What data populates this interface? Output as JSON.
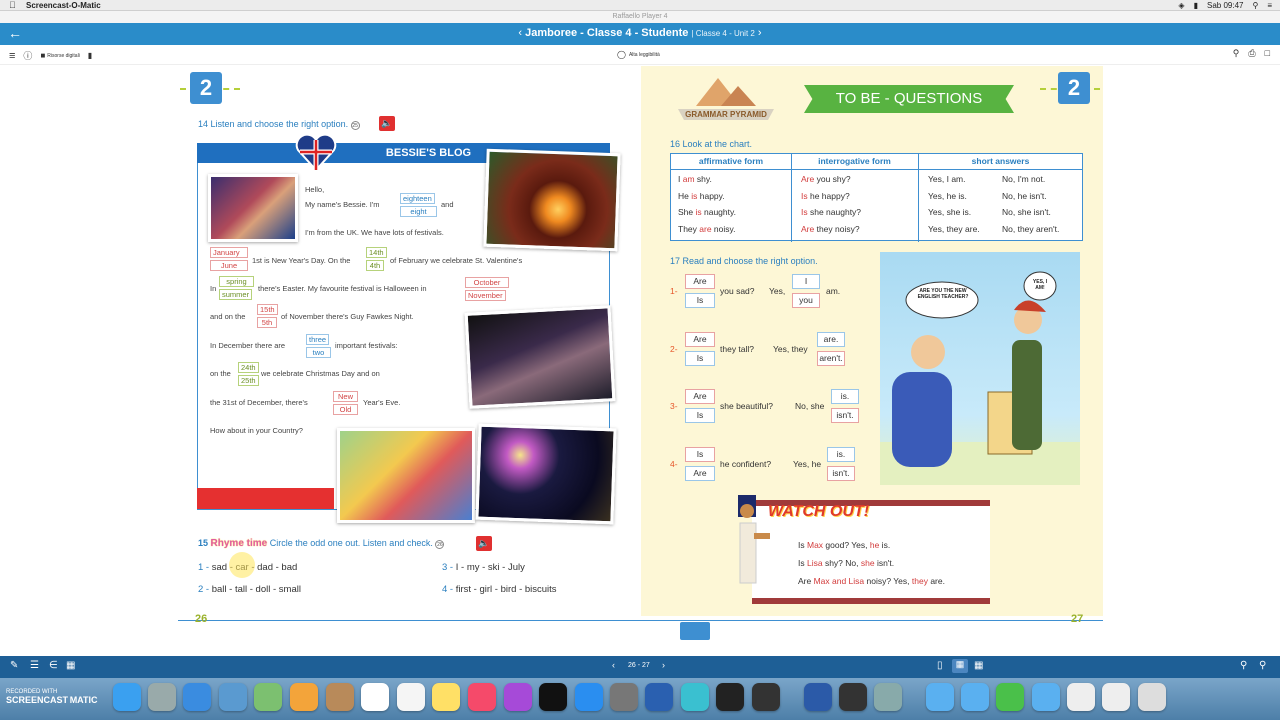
{
  "mac_menubar": {
    "app_name": "Screencast-O-Matic",
    "clock": "Sab 09:47"
  },
  "window_title": "Raffaello Player 4",
  "header": {
    "title": "Jamboree - Classe 4 - Studente",
    "subtitle": "| Classe 4 - Unit 2"
  },
  "toolbar": {
    "risorse_label": "Risorse digitali",
    "alta_leggibilita_label": "Alta leggibilità"
  },
  "left_page": {
    "unit_badge": "2",
    "ex14_title": "14 Listen and choose the right option.",
    "ex14_track": "25",
    "blog_title": "BESSIE'S BLOG",
    "blog_lines": {
      "hello": "Hello,",
      "name_pre": "My name's Bessie. I'm",
      "name_post": "and",
      "uk": "I'm from the UK. We have lots of festivals.",
      "ny": "1st is New Year's Day. On the",
      "valentine": "of February we celebrate St. Valentine's",
      "in": "In",
      "easter": "there's Easter. My favourite festival is Halloween in",
      "and_on_the": "and on the",
      "guy": "of November there's Guy Fawkes Night.",
      "dec": "In December there are",
      "important": "important festivals:",
      "on_the": "on the",
      "xmas": "we celebrate Christmas Day and on",
      "the31": "the 31st of December, there's",
      "yeareve": "Year's Eve.",
      "how": "How about in your Country?"
    },
    "options": {
      "age": [
        "eighteen",
        "eight"
      ],
      "month1": [
        "January",
        "June"
      ],
      "day1": [
        "14th",
        "4th"
      ],
      "season": [
        "spring",
        "summer"
      ],
      "month2": [
        "October",
        "November"
      ],
      "day2": [
        "15th",
        "5th"
      ],
      "count": [
        "three",
        "two"
      ],
      "day3": [
        "24th",
        "25th"
      ],
      "newold": [
        "New",
        "Old"
      ]
    },
    "ex15_num": "15",
    "ex15_rhyme": "Rhyme time",
    "ex15_instruction": "Circle the odd one out. Listen and check.",
    "ex15_track": "26",
    "ex15_items": [
      {
        "n": "1 -",
        "text": "sad - car - dad - bad"
      },
      {
        "n": "2 -",
        "text": "ball - tall - doll - small"
      },
      {
        "n": "3 -",
        "text": "I - my - ski - July"
      },
      {
        "n": "4 -",
        "text": "first - girl - bird - biscuits"
      }
    ],
    "page_number": "26"
  },
  "right_page": {
    "unit_badge": "2",
    "grammar_label": "GRAMMAR PYRAMID",
    "banner": "TO BE - QUESTIONS",
    "ex16_title": "16 Look at the chart.",
    "table": {
      "headers": [
        "affirmative form",
        "interrogative form",
        "short answers"
      ],
      "rows": [
        {
          "a1": "I",
          "a2": "am",
          "a3": "shy.",
          "i1": "Are",
          "i2": "you shy?",
          "s1": "Yes, I am.",
          "s2": "No, I'm not."
        },
        {
          "a1": "He",
          "a2": "is",
          "a3": "happy.",
          "i1": "Is",
          "i2": "he happy?",
          "s1": "Yes, he is.",
          "s2": "No, he isn't."
        },
        {
          "a1": "She",
          "a2": "is",
          "a3": "naughty.",
          "i1": "Is",
          "i2": "she naughty?",
          "s1": "Yes, she is.",
          "s2": "No, she isn't."
        },
        {
          "a1": "They",
          "a2": "are",
          "a3": "noisy.",
          "i1": "Are",
          "i2": "they noisy?",
          "s1": "Yes, they are.",
          "s2": "No, they aren't."
        }
      ]
    },
    "ex17_title": "17 Read and choose the right option.",
    "ex17_items": [
      {
        "n": "1-",
        "o1": "Are",
        "o2": "Is",
        "mid": "you sad?",
        "yes": "Yes,",
        "p1": "I",
        "p2": "you",
        "end": "am."
      },
      {
        "n": "2-",
        "o1": "Are",
        "o2": "Is",
        "mid": "they tall?",
        "yes": "Yes, they",
        "p1": "are.",
        "p2": "aren't."
      },
      {
        "n": "3-",
        "o1": "Are",
        "o2": "Is",
        "mid": "she beautiful?",
        "yes": "No, she",
        "p1": "is.",
        "p2": "isn't."
      },
      {
        "n": "4-",
        "o1": "Is",
        "o2": "Are",
        "mid": "he confident?",
        "yes": "Yes, he",
        "p1": "is.",
        "p2": "isn't."
      }
    ],
    "cartoon_bubble1": "ARE YOU THE NEW ENGLISH TEACHER?",
    "cartoon_bubble2": "YES, I AM!",
    "watch_out": "WATCH OUT!",
    "watch_lines": [
      {
        "a": "Is ",
        "b": "Max",
        "c": " good? Yes, ",
        "d": "he",
        "e": " is."
      },
      {
        "a": "Is ",
        "b": "Lisa",
        "c": " shy? No, ",
        "d": "she",
        "e": " isn't."
      },
      {
        "a": "Are ",
        "b": "Max and Lisa",
        "c": " noisy? Yes, ",
        "d": "they",
        "e": " are."
      }
    ],
    "page_number": "27"
  },
  "bottom_bar": {
    "page_indicator": "26 - 27"
  },
  "recorded": {
    "line1": "RECORDED WITH",
    "line2": "SCREENCAST",
    "line3": "MATIC"
  },
  "colors": {
    "header_blue": "#2a8cc9",
    "bottom_blue": "#1e5f96",
    "accent_red": "#d23b3b",
    "accent_green": "#9ab22b"
  }
}
